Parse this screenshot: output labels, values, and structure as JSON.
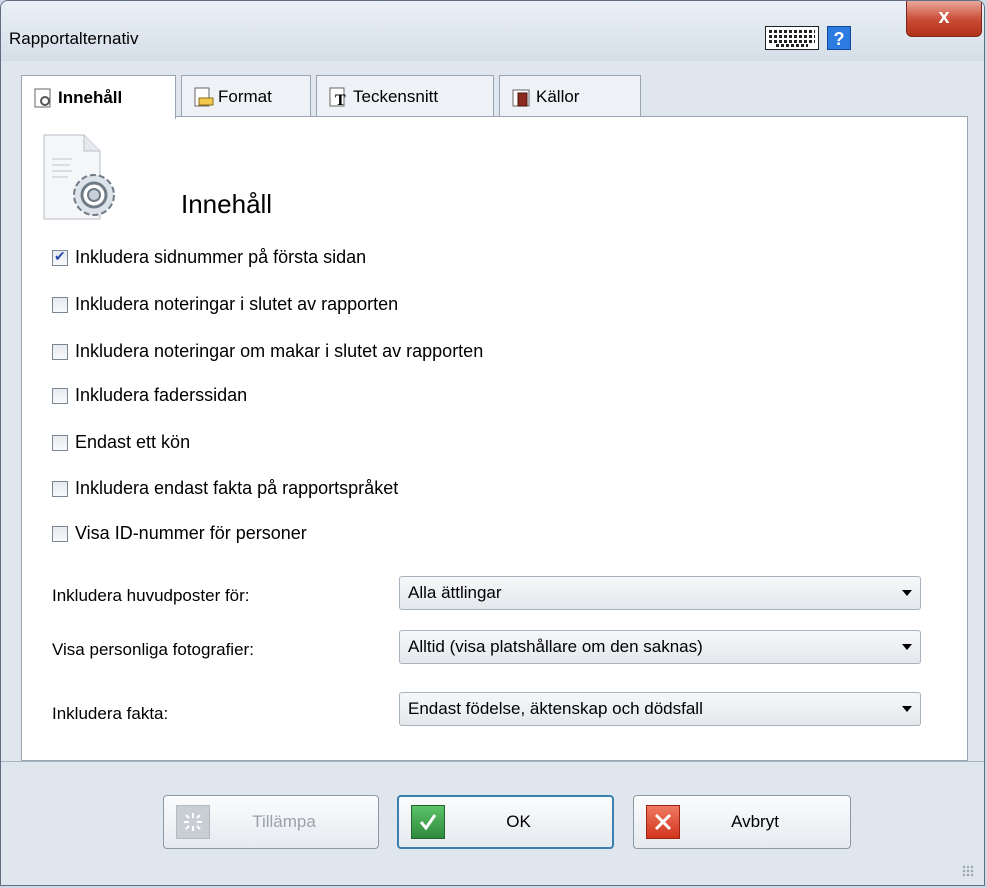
{
  "window": {
    "title": "Rapportalternativ",
    "help_label": "?",
    "close_label": "x"
  },
  "tabs": [
    {
      "label": "Innehåll",
      "icon": "gear-document-icon",
      "active": true
    },
    {
      "label": "Format",
      "icon": "format-icon",
      "active": false
    },
    {
      "label": "Teckensnitt",
      "icon": "font-icon",
      "active": false
    },
    {
      "label": "Källor",
      "icon": "sources-icon",
      "active": false
    }
  ],
  "section": {
    "title": "Innehåll",
    "icon": "settings-document-icon"
  },
  "options": [
    {
      "label": "Inkludera sidnummer på första sidan",
      "checked": true
    },
    {
      "label": "Inkludera noteringar i slutet av rapporten",
      "checked": false
    },
    {
      "label": "Inkludera noteringar om makar i slutet av rapporten",
      "checked": false
    },
    {
      "label": "Inkludera faderssidan",
      "checked": false
    },
    {
      "label": "Endast ett kön",
      "checked": false
    },
    {
      "label": "Inkludera endast fakta på rapportspråket",
      "checked": false
    },
    {
      "label": "Visa ID-nummer för personer",
      "checked": false
    }
  ],
  "fields": [
    {
      "label": "Inkludera huvudposter för:",
      "value": "Alla ättlingar"
    },
    {
      "label": "Visa personliga fotografier:",
      "value": "Alltid (visa platshållare om den saknas)"
    },
    {
      "label": "Inkludera fakta:",
      "value": "Endast födelse, äktenskap och dödsfall"
    }
  ],
  "buttons": {
    "apply": {
      "label": "Tillämpa",
      "enabled": false
    },
    "ok": {
      "label": "OK",
      "color": "#3aa14a"
    },
    "cancel": {
      "label": "Avbryt",
      "color": "#e0442c"
    }
  }
}
